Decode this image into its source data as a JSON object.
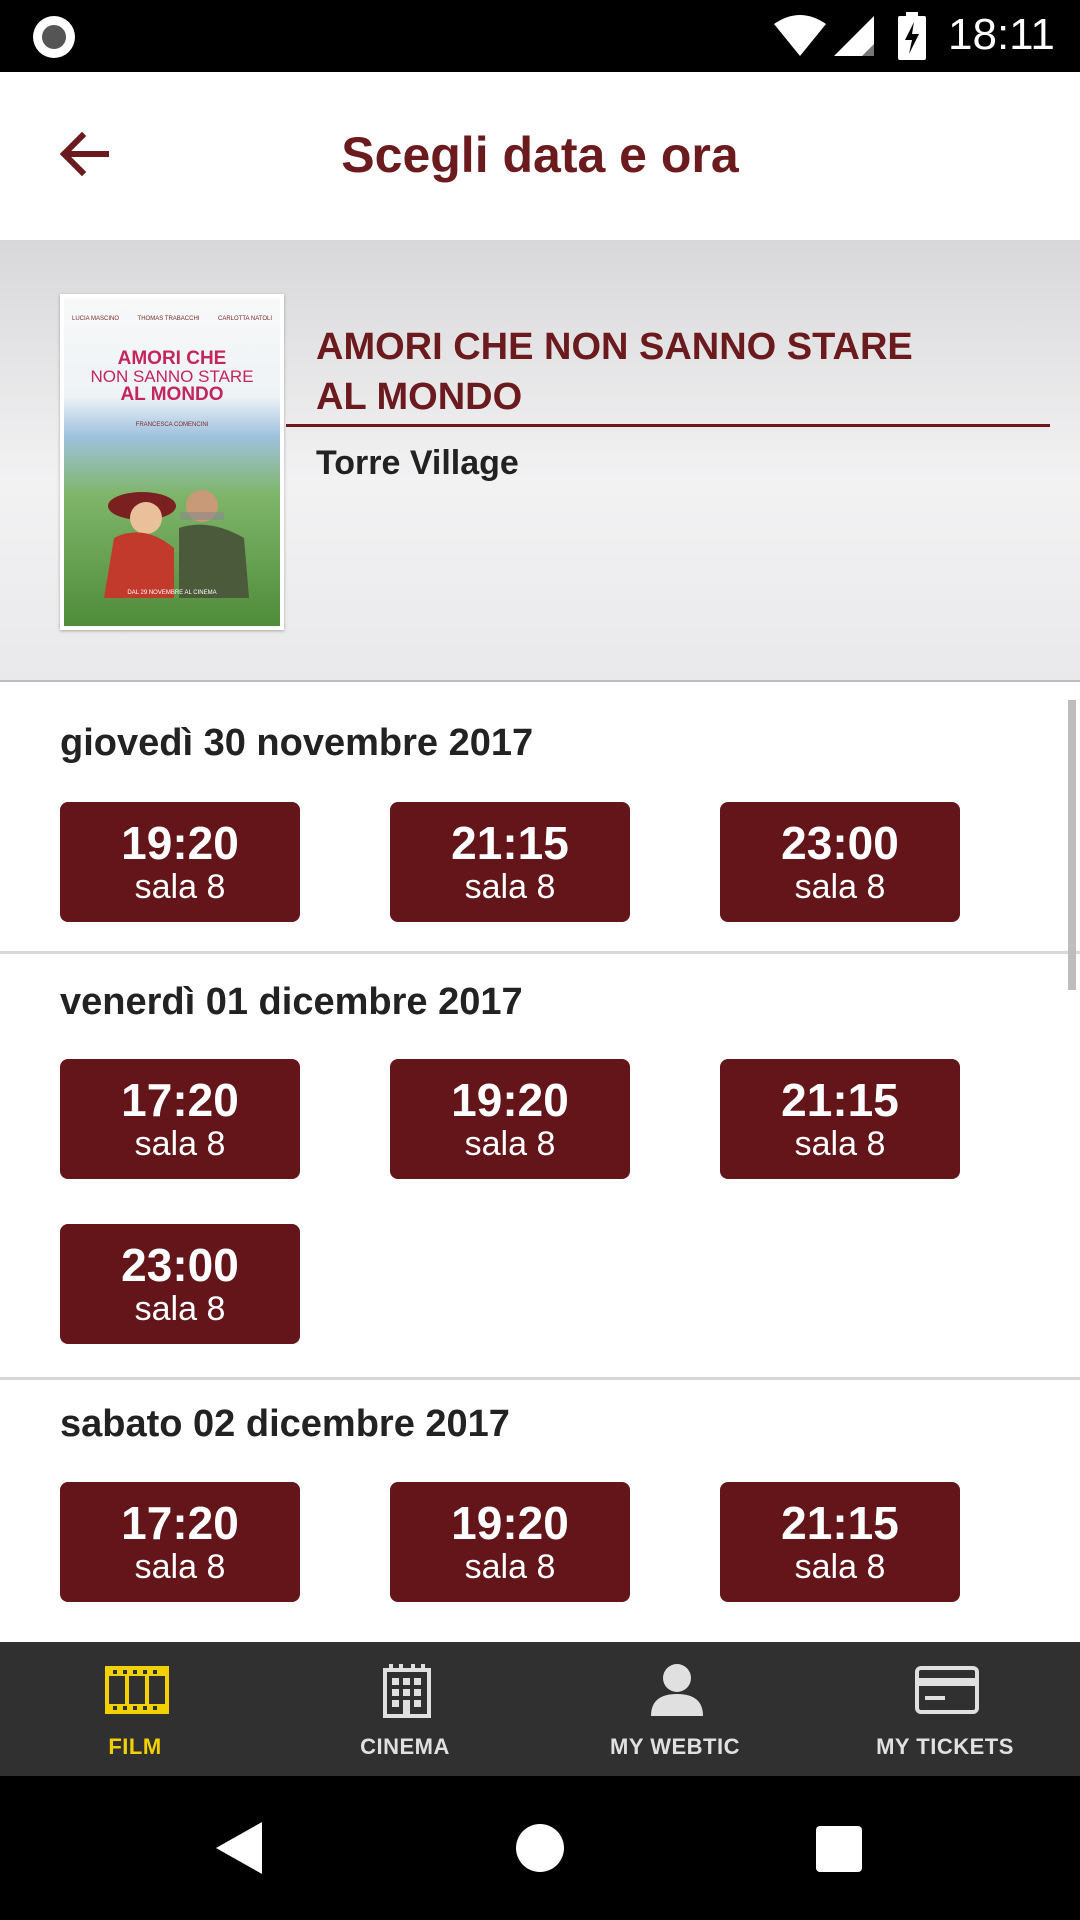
{
  "status_bar": {
    "time": "18:11"
  },
  "header": {
    "title": "Scegli data e ora"
  },
  "movie": {
    "title_line1": "AMORI CHE NON SANNO STARE",
    "title_line2": "AL MONDO",
    "cinema": "Torre Village",
    "poster": {
      "credit_1": "LUCIA MASCINO",
      "credit_2": "THOMAS TRABACCHI",
      "credit_3": "CARLOTTA NATOLI",
      "title_1": "AMORI CHE",
      "title_2": "NON SANNO STARE",
      "title_3": "AL MONDO",
      "director": "FRANCESCA COMENCINI",
      "release": "DAL 29 NOVEMBRE AL CINEMA"
    }
  },
  "days": [
    {
      "label": "giovedì 30 novembre 2017",
      "showtimes": [
        {
          "time": "19:20",
          "hall": "sala 8"
        },
        {
          "time": "21:15",
          "hall": "sala 8"
        },
        {
          "time": "23:00",
          "hall": "sala 8"
        }
      ]
    },
    {
      "label": "venerdì 01 dicembre 2017",
      "showtimes": [
        {
          "time": "17:20",
          "hall": "sala 8"
        },
        {
          "time": "19:20",
          "hall": "sala 8"
        },
        {
          "time": "21:15",
          "hall": "sala 8"
        },
        {
          "time": "23:00",
          "hall": "sala 8"
        }
      ]
    },
    {
      "label": "sabato 02 dicembre 2017",
      "showtimes": [
        {
          "time": "17:20",
          "hall": "sala 8"
        },
        {
          "time": "19:20",
          "hall": "sala 8"
        },
        {
          "time": "21:15",
          "hall": "sala 8"
        }
      ]
    }
  ],
  "bottom_nav": {
    "items": [
      {
        "label": "FILM",
        "icon": "film-icon",
        "active": true
      },
      {
        "label": "CINEMA",
        "icon": "building-icon",
        "active": false
      },
      {
        "label": "MY WEBTIC",
        "icon": "user-icon",
        "active": false
      },
      {
        "label": "MY TICKETS",
        "icon": "card-icon",
        "active": false
      }
    ]
  },
  "colors": {
    "accent": "#63151a",
    "title": "#6b1a1e",
    "active_nav": "#f2d100",
    "nav_bg": "#303030"
  }
}
